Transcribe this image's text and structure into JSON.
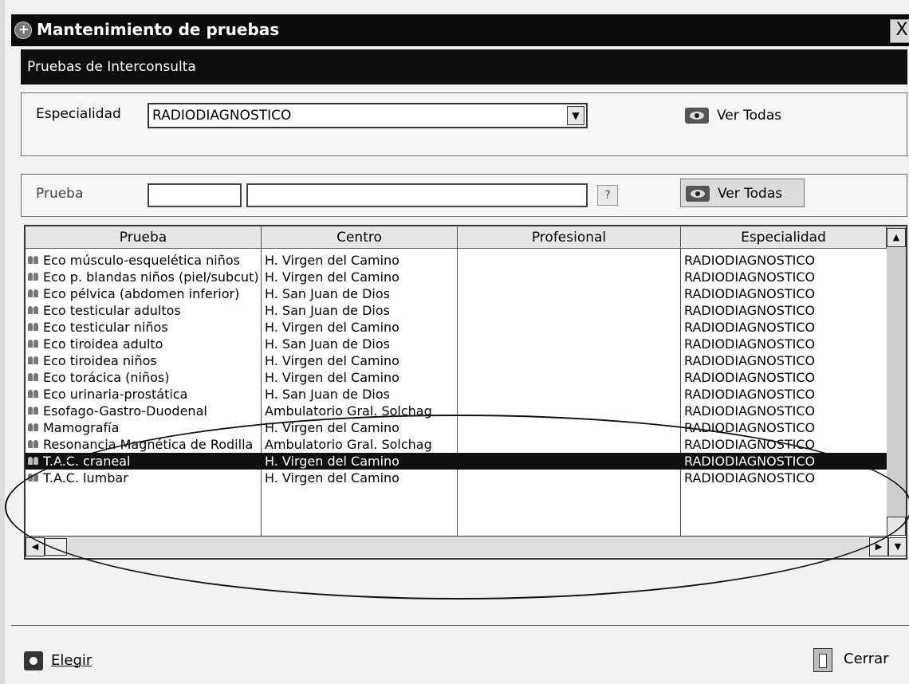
{
  "window": {
    "title": "Mantenimiento de pruebas",
    "close_label": "X"
  },
  "subtitle": "Pruebas de Interconsulta",
  "especialidad": {
    "label": "Especialidad",
    "value": "RADIODIAGNOSTICO",
    "ver_todas": "Ver Todas"
  },
  "prueba": {
    "label": "Prueba",
    "code_value": "",
    "name_value": "",
    "help": "?",
    "ver_todas": "Ver Todas"
  },
  "grid": {
    "columns": [
      "Prueba",
      "Centro",
      "Profesional",
      "Especialidad"
    ],
    "rows": [
      [
        "Eco músculo-esquelética niños",
        "H. Virgen del Camino",
        "",
        "RADIODIAGNOSTICO"
      ],
      [
        "Eco p. blandas niños (piel/subcut)",
        "H. Virgen del Camino",
        "",
        "RADIODIAGNOSTICO"
      ],
      [
        "Eco pélvica (abdomen inferior)",
        "H. San Juan de Dios",
        "",
        "RADIODIAGNOSTICO"
      ],
      [
        "Eco testicular adultos",
        "H. San Juan de Dios",
        "",
        "RADIODIAGNOSTICO"
      ],
      [
        "Eco testicular niños",
        "H. Virgen del Camino",
        "",
        "RADIODIAGNOSTICO"
      ],
      [
        "Eco tiroidea adulto",
        "H. San Juan de Dios",
        "",
        "RADIODIAGNOSTICO"
      ],
      [
        "Eco tiroidea niños",
        "H. Virgen del Camino",
        "",
        "RADIODIAGNOSTICO"
      ],
      [
        "Eco torácica (niños)",
        "H. Virgen del Camino",
        "",
        "RADIODIAGNOSTICO"
      ],
      [
        "Eco urinaria-prostática",
        "H. San Juan de Dios",
        "",
        "RADIODIAGNOSTICO"
      ],
      [
        "Esofago-Gastro-Duodenal",
        "Ambulatorio Gral. Solchag",
        "",
        "RADIODIAGNOSTICO"
      ],
      [
        "Mamografía",
        "H. Virgen del Camino",
        "",
        "RADIODIAGNOSTICO"
      ],
      [
        "Resonancia Magnética de Rodilla",
        "Ambulatorio Gral. Solchag",
        "",
        "RADIODIAGNOSTICO"
      ],
      [
        "T.A.C. craneal",
        "H. Virgen del Camino",
        "",
        "RADIODIAGNOSTICO"
      ],
      [
        "T.A.C. lumbar",
        "H. Virgen del Camino",
        "",
        "RADIODIAGNOSTICO"
      ]
    ],
    "selected_row": 12
  },
  "footer": {
    "elegir": "Elegir",
    "cerrar": "Cerrar"
  }
}
